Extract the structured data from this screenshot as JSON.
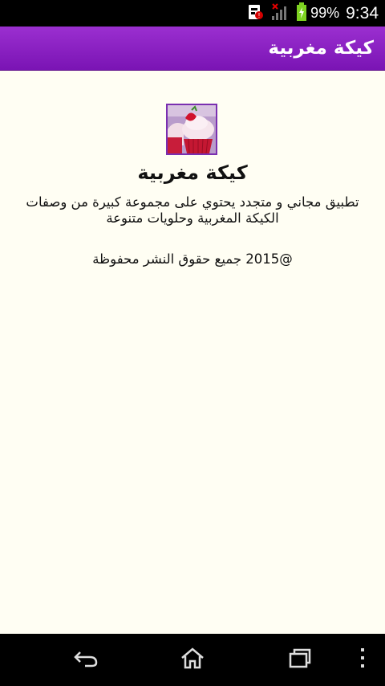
{
  "status_bar": {
    "battery_percent": "99%",
    "time": "9:34",
    "icons": [
      "notification-icon",
      "signal-no-service-icon",
      "battery-charging-icon"
    ],
    "battery_level": 0.99
  },
  "action_bar": {
    "title": "كيكة مغربية"
  },
  "about": {
    "app_icon": "cupcake-app-icon",
    "app_name": "كيكة مغربية",
    "description": "تطبيق مجاني و متجدد يحتوي على مجموعة كبيرة من وصفات الكيكة المغربية وحلويات متنوعة",
    "copyright": "@2015 جميع حقوق النشر محفوظة"
  },
  "nav_bar": {
    "buttons": [
      "back-icon",
      "home-icon",
      "recent-apps-icon",
      "overflow-menu-icon"
    ]
  },
  "colors": {
    "action_bar": "#8a1fc3",
    "background": "#fffef3",
    "status_bar": "#000000"
  }
}
